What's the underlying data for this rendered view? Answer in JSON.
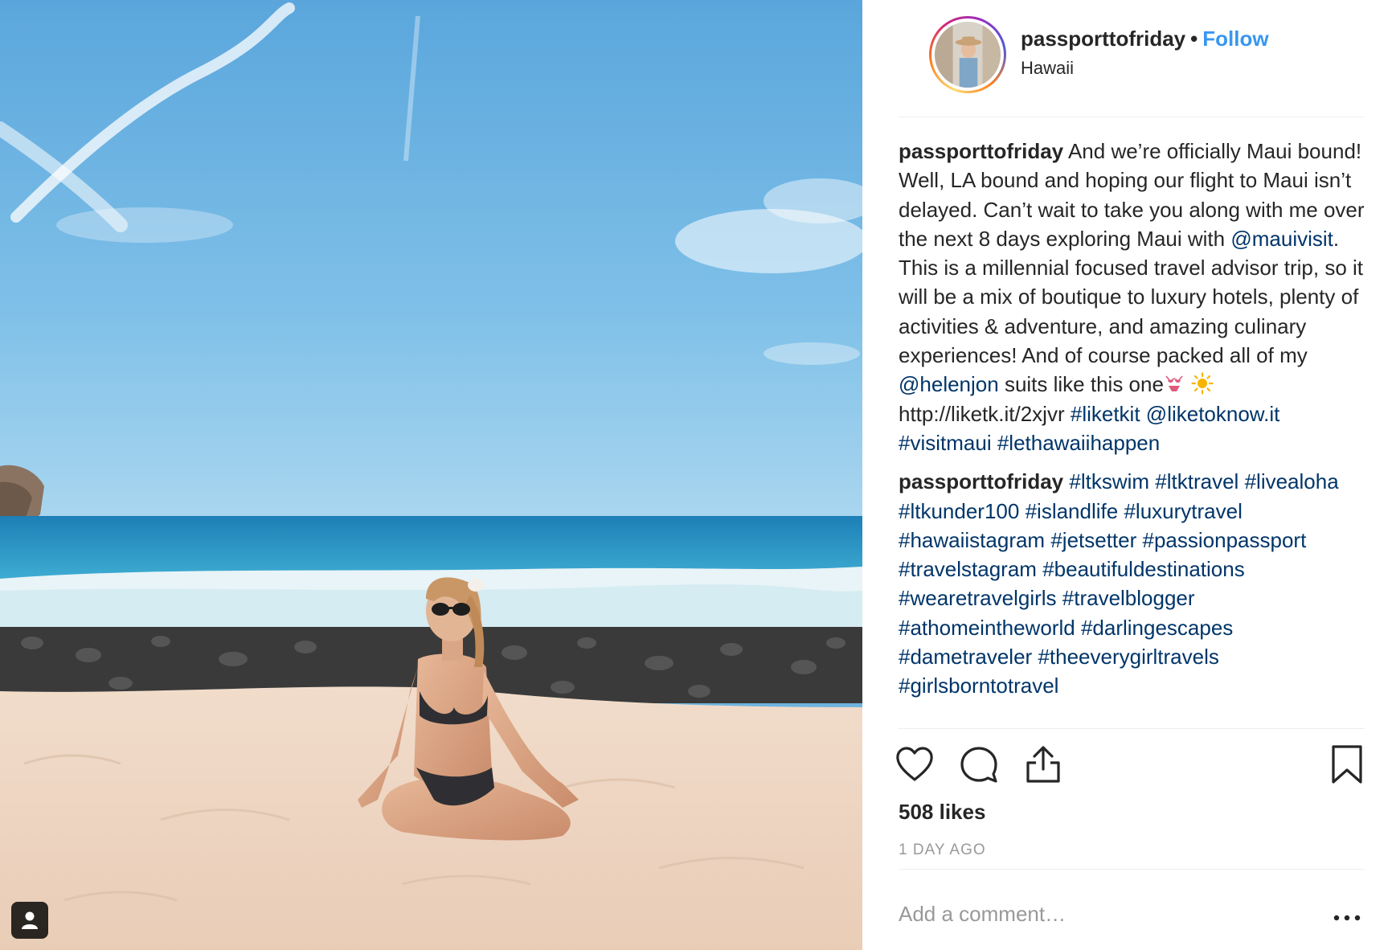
{
  "post": {
    "photo": {
      "description_icon": "user-tag-icon"
    },
    "header": {
      "username": "passporttofriday",
      "separator": "•",
      "follow_label": "Follow",
      "location": "Hawaii"
    },
    "caption": {
      "author": "passporttofriday",
      "text_1": "And we’re officially Maui bound! Well, LA bound and hoping our flight to Maui isn’t delayed. Can’t wait to take you along with me over the next 8 days exploring Maui with ",
      "mention_1": "@mauivisit",
      "text_2": ". This is a millennial focused travel advisor trip, so it will be a mix of boutique to luxury hotels, plenty of activities & adventure, and amazing culinary experiences! And of course packed all of my ",
      "mention_2": "@helenjon",
      "text_3": " suits like this one",
      "link": "http://liketk.it/2xjvr",
      "hashtag_1": "#liketkit",
      "mention_3": "@liketoknow.it",
      "hashtag_2": "#visitmaui",
      "hashtag_3": "#lethawaiihappen"
    },
    "hashtag_comment": {
      "author": "passporttofriday",
      "tags": [
        "#ltkswim",
        "#ltktravel",
        "#livealoha",
        "#ltkunder100",
        "#islandlife",
        "#luxurytravel",
        "#hawaiistagram",
        "#jetsetter",
        "#passionpassport",
        "#travelstagram",
        "#beautifuldestinations",
        "#wearetravelgirls",
        "#travelblogger",
        "#athomeintheworld",
        "#darlingescapes",
        "#dametraveler",
        "#theeverygirltravels",
        "#girlsborntotravel"
      ]
    },
    "actions": {
      "like_icon": "heart-icon",
      "comment_icon": "comment-bubble-icon",
      "share_icon": "share-upload-icon",
      "save_icon": "bookmark-icon"
    },
    "likes_text": "508 likes",
    "timestamp": "1 DAY AGO",
    "comment_placeholder": "Add a comment…",
    "more_icon": "more-options-icon"
  },
  "colors": {
    "link": "#003569",
    "follow": "#3897f0",
    "muted": "#999999",
    "text": "#262626"
  }
}
